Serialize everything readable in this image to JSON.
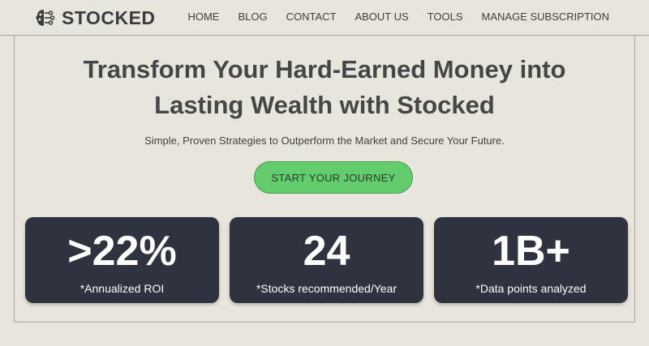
{
  "brand": {
    "name": "STOCKED",
    "icon": "brain-circuit-icon"
  },
  "nav": [
    {
      "label": "HOME"
    },
    {
      "label": "BLOG"
    },
    {
      "label": "CONTACT"
    },
    {
      "label": "ABOUT US"
    },
    {
      "label": "TOOLS"
    },
    {
      "label": "MANAGE SUBSCRIPTION"
    }
  ],
  "hero": {
    "headline_line1": "Transform Your Hard-Earned Money into",
    "headline_line2": "Lasting Wealth with Stocked",
    "subheading": "Simple, Proven Strategies to Outperform the Market and Secure Your Future.",
    "cta_label": "START YOUR JOURNEY"
  },
  "stats": [
    {
      "value": ">22%",
      "label": "*Annualized ROI"
    },
    {
      "value": "24",
      "label": "*Stocks recommended/Year"
    },
    {
      "value": "1B+",
      "label": "*Data points analyzed"
    }
  ],
  "colors": {
    "background": "#e8e6dc",
    "card": "#2e333f",
    "cta": "#63cc6d"
  }
}
